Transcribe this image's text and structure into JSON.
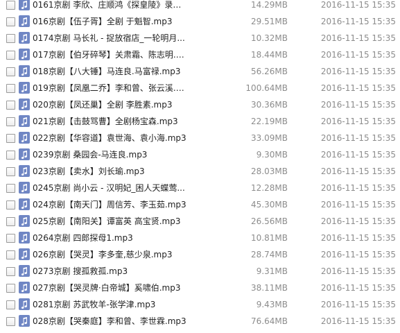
{
  "icon_color": "#6f86c4",
  "files": [
    {
      "name": "0161京剧 李欣、庄顺鸿《探皇陵》录音...",
      "size": "14.29MB",
      "modified": "2016-11-15 15:35",
      "icon": "music-note-icon"
    },
    {
      "name": "016京剧【伍子胥】全剧 于魁智.mp3",
      "size": "29.51MB",
      "modified": "2016-11-15 15:35",
      "icon": "music-note-icon"
    },
    {
      "name": "0174京剧 马长礼 - 捉放宿店_一轮明月...",
      "size": "10.32MB",
      "modified": "2016-11-15 15:35",
      "icon": "music-note-icon"
    },
    {
      "name": "017京剧【伯牙碎琴】关肃霜、陈志明.m...",
      "size": "18.44MB",
      "modified": "2016-11-15 15:35",
      "icon": "music-note-icon"
    },
    {
      "name": "018京剧【八大锤】马连良.马富禄.mp3",
      "size": "56.26MB",
      "modified": "2016-11-15 15:35",
      "icon": "music-note-icon"
    },
    {
      "name": "019京剧【凤凰二乔】李和曾、张云溪.m...",
      "size": "100.64MB",
      "modified": "2016-11-15 15:35",
      "icon": "music-note-icon"
    },
    {
      "name": "020京剧【凤还巢】全剧 李胜素.mp3",
      "size": "30.36MB",
      "modified": "2016-11-15 15:35",
      "icon": "music-note-icon"
    },
    {
      "name": "021京剧【击鼓骂曹】全剧杨宝森.mp3",
      "size": "22.19MB",
      "modified": "2016-11-15 15:35",
      "icon": "music-note-icon"
    },
    {
      "name": "022京剧【华容道】袁世海、袁小海.mp3",
      "size": "33.09MB",
      "modified": "2016-11-15 15:35",
      "icon": "music-note-icon"
    },
    {
      "name": "0239京剧 桑园会-马连良.mp3",
      "size": "9.30MB",
      "modified": "2016-11-15 15:35",
      "icon": "music-note-icon"
    },
    {
      "name": "023京剧【卖水】刘长瑜.mp3",
      "size": "28.03MB",
      "modified": "2016-11-15 15:35",
      "icon": "music-note-icon"
    },
    {
      "name": "0245京剧 尚小云 - 汉明妃_困人天蝶莺...",
      "size": "12.28MB",
      "modified": "2016-11-15 15:35",
      "icon": "music-note-icon"
    },
    {
      "name": "024京剧【南天门】周信芳、李玉茹.mp3",
      "size": "45.30MB",
      "modified": "2016-11-15 15:35",
      "icon": "music-note-icon"
    },
    {
      "name": "025京剧【南阳关】谭富英 高宝贤.mp3",
      "size": "26.56MB",
      "modified": "2016-11-15 15:35",
      "icon": "music-note-icon"
    },
    {
      "name": "0264京剧 四郎探母1.mp3",
      "size": "10.81MB",
      "modified": "2016-11-15 15:35",
      "icon": "music-note-icon"
    },
    {
      "name": "026京剧【哭灵】李多奎,慈少泉.mp3",
      "size": "28.74MB",
      "modified": "2016-11-15 15:35",
      "icon": "music-note-icon"
    },
    {
      "name": "0273京剧 搜孤救孤.mp3",
      "size": "9.31MB",
      "modified": "2016-11-15 15:35",
      "icon": "music-note-icon"
    },
    {
      "name": "027京剧【哭灵牌·白帝城】奚啸伯.mp3",
      "size": "38.11MB",
      "modified": "2016-11-15 15:35",
      "icon": "music-note-icon"
    },
    {
      "name": "0281京剧 苏武牧羊-张学津.mp3",
      "size": "9.43MB",
      "modified": "2016-11-15 15:35",
      "icon": "music-note-icon"
    },
    {
      "name": "028京剧【哭秦庭】李和曾、李世霖.mp3",
      "size": "76.64MB",
      "modified": "2016-11-15 15:35",
      "icon": "music-note-icon"
    }
  ]
}
